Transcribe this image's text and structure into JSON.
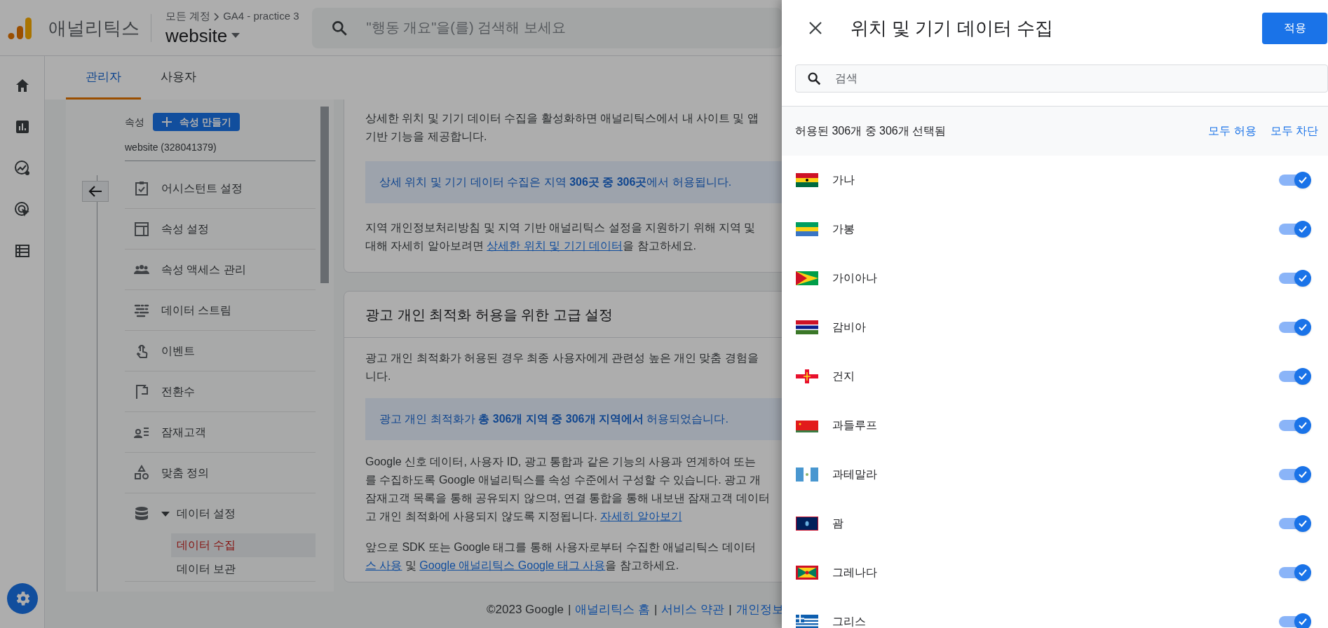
{
  "header": {
    "app_name": "애널리틱스",
    "breadcrumb": [
      "모든 계정",
      "GA4 - practice 3"
    ],
    "property": "website",
    "search": {
      "placeholder": "\"행동 개요\"을(를) 검색해 보세요"
    }
  },
  "admin_tabs": [
    {
      "label": "관리자",
      "selected": true
    },
    {
      "label": "사용자",
      "selected": false
    }
  ],
  "property_nav": {
    "label": "속성",
    "create_button": "속성 만들기",
    "property_id": "website (328041379)",
    "items": [
      {
        "label": "어시스턴트 설정",
        "selected": false
      },
      {
        "label": "속성 설정",
        "selected": false
      },
      {
        "label": "속성 액세스 관리",
        "selected": false
      },
      {
        "label": "데이터 스트림",
        "selected": false
      },
      {
        "label": "이벤트",
        "selected": false
      },
      {
        "label": "전환수",
        "selected": false
      },
      {
        "label": "잠재고객",
        "selected": false
      },
      {
        "label": "맞춤 정의",
        "selected": false
      },
      {
        "label": "데이터 설정",
        "selected": false,
        "expanded": true,
        "children": [
          {
            "label": "데이터 수집",
            "selected": true
          },
          {
            "label": "데이터 보관",
            "selected": false
          }
        ]
      }
    ]
  },
  "cards": [
    {
      "blocks": [
        {
          "kind": "text",
          "lines": [
            [
              {
                "kind": "plain",
                "text": "상세한 위치 및 기기 데이터 수집을 활성화하면 애널리틱스에서 내 사이트 및 앱"
              }
            ],
            [
              {
                "kind": "plain",
                "text": "기반 기능을 제공합니다."
              }
            ]
          ]
        },
        {
          "kind": "notice",
          "text": "상세 위치 및 기기 데이터 수집은 지역 **306곳 중 306곳**에서 허용됩니다."
        },
        {
          "kind": "text",
          "lines": [
            [
              {
                "kind": "plain",
                "text": "지역 개인정보처리방침 및 지역 기반 애널리틱스 설정을 지원하기 위해 지역 및"
              }
            ],
            [
              {
                "kind": "plain",
                "text": "대해 자세히 알아보려면 "
              },
              {
                "kind": "link",
                "text": "상세한 위치 및 기기 데이터"
              },
              {
                "kind": "plain",
                "text": "을 참고하세요."
              }
            ]
          ]
        }
      ]
    },
    {
      "title": "광고 개인 최적화 허용을 위한 고급 설정",
      "blocks": [
        {
          "kind": "text",
          "lines": [
            [
              {
                "kind": "plain",
                "text": "광고 개인 최적화가 허용된 경우 최종 사용자에게 관련성 높은 개인 맞춤 경험을"
              }
            ],
            [
              {
                "kind": "plain",
                "text": "니다."
              }
            ]
          ]
        },
        {
          "kind": "notice",
          "text": "광고 개인 최적화가 **총 306개 지역 중 306개 지역에서** 허용되었습니다."
        },
        {
          "kind": "text",
          "lines": [
            [
              {
                "kind": "plain",
                "text": "Google 신호 데이터, 사용자 ID, 광고 통합과 같은 기능의 사용과 연계하여 또는"
              }
            ],
            [
              {
                "kind": "plain",
                "text": "를 수집하도록 Google 애널리틱스를 속성 수준에서 구성할 수 있습니다. 광고 개"
              }
            ],
            [
              {
                "kind": "plain",
                "text": "잠재고객 목록을 통해 공유되지 않으며, 연결 통합을 통해 내보낸 잠재고객 데이터"
              }
            ],
            [
              {
                "kind": "plain",
                "text": "고 개인 최적화에 사용되지 않도록 지정됩니다. "
              },
              {
                "kind": "link",
                "text": "자세히 알아보기"
              }
            ]
          ]
        },
        {
          "kind": "text",
          "lines": [
            [
              {
                "kind": "plain",
                "text": "앞으로 SDK 또는 Google 태그를 통해 사용자로부터 수집한 애널리틱스 데이터"
              }
            ],
            [
              {
                "kind": "link",
                "text": "스 사용"
              },
              {
                "kind": "plain",
                "text": " 및 "
              },
              {
                "kind": "link",
                "text": "Google 애널리틱스 Google 태그 사용"
              },
              {
                "kind": "plain",
                "text": "을 참고하세요."
              }
            ]
          ]
        }
      ]
    }
  ],
  "footer": [
    {
      "kind": "plain",
      "text": "©2023 Google"
    },
    {
      "kind": "sep",
      "text": "|"
    },
    {
      "kind": "link",
      "text": "애널리틱스 홈"
    },
    {
      "kind": "sep",
      "text": "|"
    },
    {
      "kind": "link",
      "text": "서비스 약관"
    },
    {
      "kind": "sep",
      "text": "|"
    },
    {
      "kind": "link",
      "text": "개인정보"
    }
  ],
  "panel": {
    "title": "위치 및 기기 데이터 수집",
    "apply_button": "적용",
    "search": {
      "placeholder": "검색"
    },
    "summary": "허용된 306개 중 306개 선택됨",
    "allow_all": "모두 허용",
    "block_all": "모두 차단",
    "regions": [
      {
        "name": "가나",
        "on": true
      },
      {
        "name": "가봉",
        "on": true
      },
      {
        "name": "가이아나",
        "on": true
      },
      {
        "name": "감비아",
        "on": true
      },
      {
        "name": "건지",
        "on": true
      },
      {
        "name": "과들루프",
        "on": true
      },
      {
        "name": "과테말라",
        "on": true
      },
      {
        "name": "괌",
        "on": true
      },
      {
        "name": "그레나다",
        "on": true
      },
      {
        "name": "그리스",
        "on": true
      }
    ]
  }
}
